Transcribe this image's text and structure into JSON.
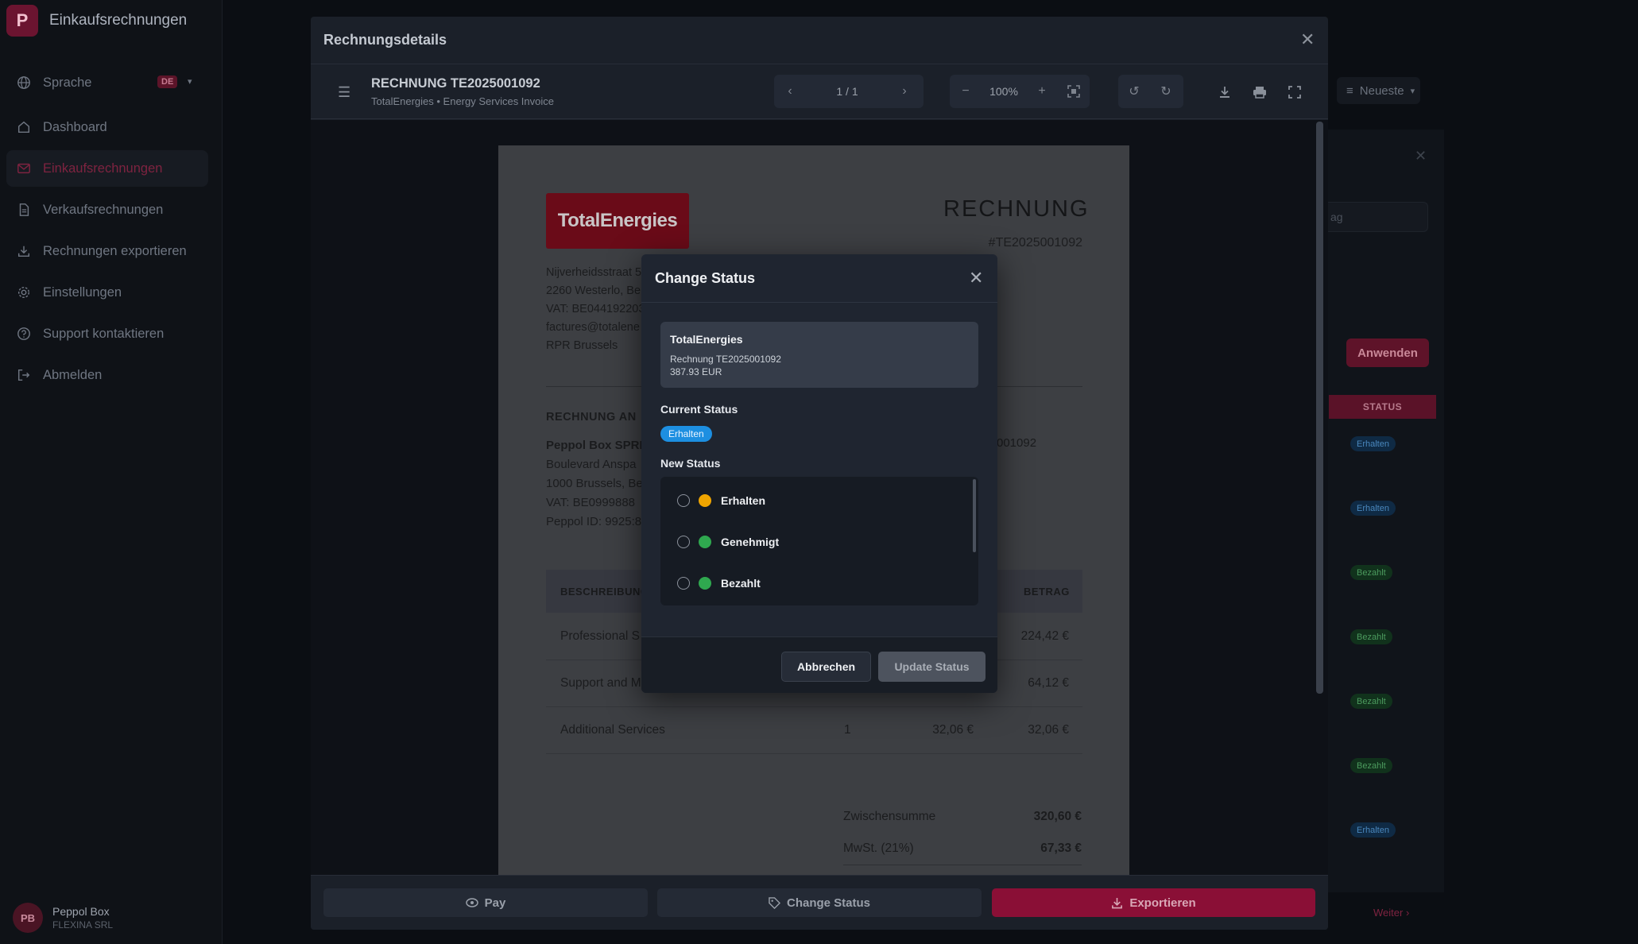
{
  "app": {
    "brand_letter": "P",
    "brand_name": "Einkaufsrechnungen",
    "language_label": "Sprache",
    "language_badge": "DE",
    "nav": [
      {
        "label": "Dashboard",
        "icon": "home-icon"
      },
      {
        "label": "Einkaufsrechnungen",
        "icon": "mail-icon",
        "active": true
      },
      {
        "label": "Verkaufsrechnungen",
        "icon": "document-icon"
      },
      {
        "label": "Rechnungen exportieren",
        "icon": "download-icon"
      },
      {
        "label": "Einstellungen",
        "icon": "gear-icon"
      },
      {
        "label": "Support kontaktieren",
        "icon": "help-icon"
      },
      {
        "label": "Abmelden",
        "icon": "logout-icon"
      }
    ],
    "user": {
      "initials": "PB",
      "name": "Peppol Box",
      "org": "FLEXINA SRL"
    }
  },
  "background": {
    "sort_label": "Neueste",
    "filter_placeholder": "ag",
    "apply_label": "Anwenden",
    "status_column": "STATUS",
    "statuses": [
      "Erhalten",
      "Erhalten",
      "Bezahlt",
      "Bezahlt",
      "Bezahlt",
      "Bezahlt",
      "Erhalten"
    ],
    "next_label": "Weiter"
  },
  "modal": {
    "title": "Rechnungsdetails",
    "invoice_title": "RECHNUNG TE2025001092",
    "invoice_subtitle": "TotalEnergies • Energy Services Invoice",
    "page_indicator": "1 / 1",
    "zoom": "100%",
    "footer": {
      "pay": "Pay",
      "change_status": "Change Status",
      "export": "Exportieren"
    }
  },
  "document": {
    "logo_text": "TotalEnergies",
    "heading": "RECHNUNG",
    "number": "#TE2025001092",
    "sender_lines": [
      "Nijverheidsstraat 5",
      "2260 Westerlo, Be",
      "VAT: BE044192203",
      "factures@totalene",
      "RPR Brussels"
    ],
    "bill_to_heading": "RECHNUNG AN",
    "bill_to_name": "Peppol Box SPRL",
    "bill_to_lines": [
      "Boulevard Anspa",
      "1000 Brussels, Be",
      "VAT: BE0999888",
      "Peppol ID: 9925:8"
    ],
    "bill_ref": "001092",
    "table_headers": {
      "description": "BESCHREIBUNG",
      "amount": "BETRAG"
    },
    "rows": [
      {
        "description": "Professional S",
        "qty": "",
        "price": "",
        "amount": "224,42 €"
      },
      {
        "description": "Support and M",
        "qty": "",
        "price": "",
        "amount": "64,12 €"
      },
      {
        "description": "Additional Services",
        "qty": "1",
        "price": "32,06 €",
        "amount": "32,06 €"
      }
    ],
    "subtotal_label": "Zwischensumme",
    "subtotal": "320,60 €",
    "vat_label": "MwSt. (21%)",
    "vat": "67,33 €"
  },
  "dialog": {
    "title": "Change Status",
    "card": {
      "name": "TotalEnergies",
      "invoice": "Rechnung TE2025001092",
      "amount": "387.93 EUR"
    },
    "current_status_label": "Current Status",
    "current_status": "Erhalten",
    "new_status_label": "New Status",
    "options": [
      {
        "label": "Erhalten",
        "color": "#f0a500"
      },
      {
        "label": "Genehmigt",
        "color": "#2fa84f"
      },
      {
        "label": "Bezahlt",
        "color": "#2fa84f"
      }
    ],
    "cancel_label": "Abbrechen",
    "update_label": "Update Status"
  }
}
